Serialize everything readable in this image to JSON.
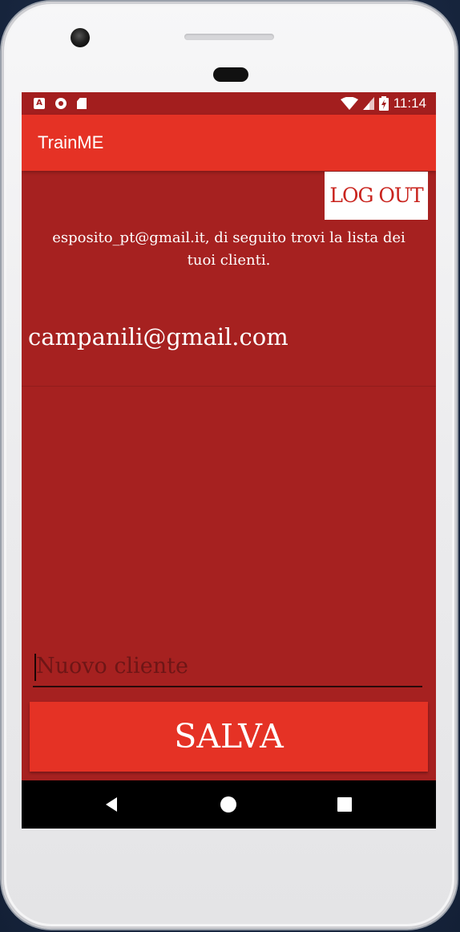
{
  "status_bar": {
    "left_icons": [
      "a-notification-icon",
      "record-icon",
      "sd-card-icon"
    ],
    "a_glyph": "A",
    "right_icons": [
      "wifi-icon",
      "cell-signal-icon",
      "battery-charging-icon"
    ],
    "time": "11:14"
  },
  "app_bar": {
    "title": "TrainME"
  },
  "main": {
    "logout_label": "LOG OUT",
    "intro_text": "esposito_pt@gmail.it, di seguito trovi la lista dei tuoi clienti.",
    "clients": [
      "campanili@gmail.com"
    ],
    "new_client_placeholder": "Nuovo cliente",
    "new_client_value": "",
    "save_label": "SALVA"
  },
  "nav_bar": {
    "buttons": [
      "back-icon",
      "home-icon",
      "recents-icon"
    ]
  },
  "colors": {
    "background": "#a62120",
    "accent": "#e53225",
    "status_bar": "#a31e1e",
    "logout_text": "#c9241e"
  }
}
